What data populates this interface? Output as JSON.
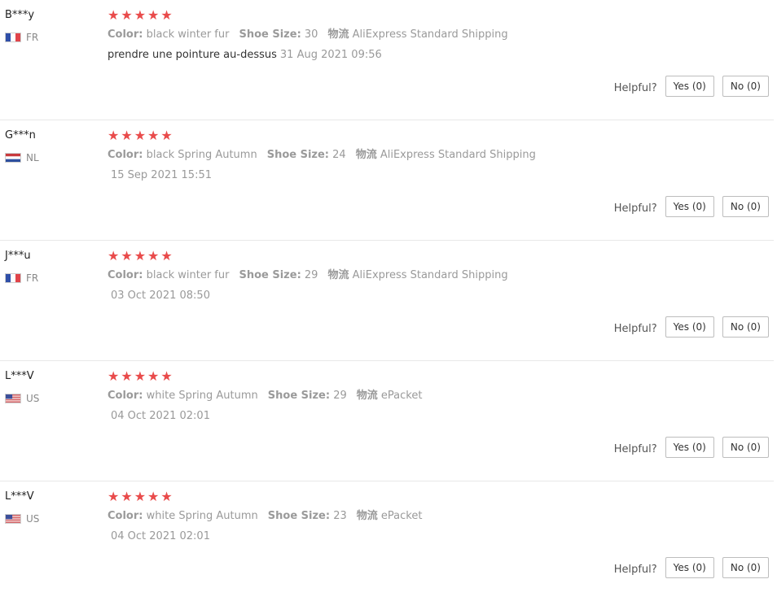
{
  "helpful_label": "Helpful?",
  "reviews": [
    {
      "user": "B***y",
      "country": "FR",
      "flag": "fr",
      "rating": 5,
      "attrs": [
        {
          "key": "Color:",
          "value": "black winter fur"
        },
        {
          "key": "Shoe Size:",
          "value": "30"
        },
        {
          "key": "物流",
          "value": "AliExpress Standard Shipping"
        }
      ],
      "text": "prendre une pointure au-dessus",
      "date": "31 Aug 2021 09:56",
      "yes_label": "Yes (0)",
      "no_label": "No (0)"
    },
    {
      "user": "G***n",
      "country": "NL",
      "flag": "nl",
      "rating": 5,
      "attrs": [
        {
          "key": "Color:",
          "value": "black Spring Autumn"
        },
        {
          "key": "Shoe Size:",
          "value": "24"
        },
        {
          "key": "物流",
          "value": "AliExpress Standard Shipping"
        }
      ],
      "text": "",
      "date": "15 Sep 2021 15:51",
      "yes_label": "Yes (0)",
      "no_label": "No (0)"
    },
    {
      "user": "J***u",
      "country": "FR",
      "flag": "fr",
      "rating": 5,
      "attrs": [
        {
          "key": "Color:",
          "value": "black winter fur"
        },
        {
          "key": "Shoe Size:",
          "value": "29"
        },
        {
          "key": "物流",
          "value": "AliExpress Standard Shipping"
        }
      ],
      "text": "",
      "date": "03 Oct 2021 08:50",
      "yes_label": "Yes (0)",
      "no_label": "No (0)"
    },
    {
      "user": "L***V",
      "country": "US",
      "flag": "us",
      "rating": 5,
      "attrs": [
        {
          "key": "Color:",
          "value": "white Spring Autumn"
        },
        {
          "key": "Shoe Size:",
          "value": "29"
        },
        {
          "key": "物流",
          "value": "ePacket"
        }
      ],
      "text": "",
      "date": "04 Oct 2021 02:01",
      "yes_label": "Yes (0)",
      "no_label": "No (0)"
    },
    {
      "user": "L***V",
      "country": "US",
      "flag": "us",
      "rating": 5,
      "attrs": [
        {
          "key": "Color:",
          "value": "white Spring Autumn"
        },
        {
          "key": "Shoe Size:",
          "value": "23"
        },
        {
          "key": "物流",
          "value": "ePacket"
        }
      ],
      "text": "",
      "date": "04 Oct 2021 02:01",
      "yes_label": "Yes (0)",
      "no_label": "No (0)"
    }
  ]
}
